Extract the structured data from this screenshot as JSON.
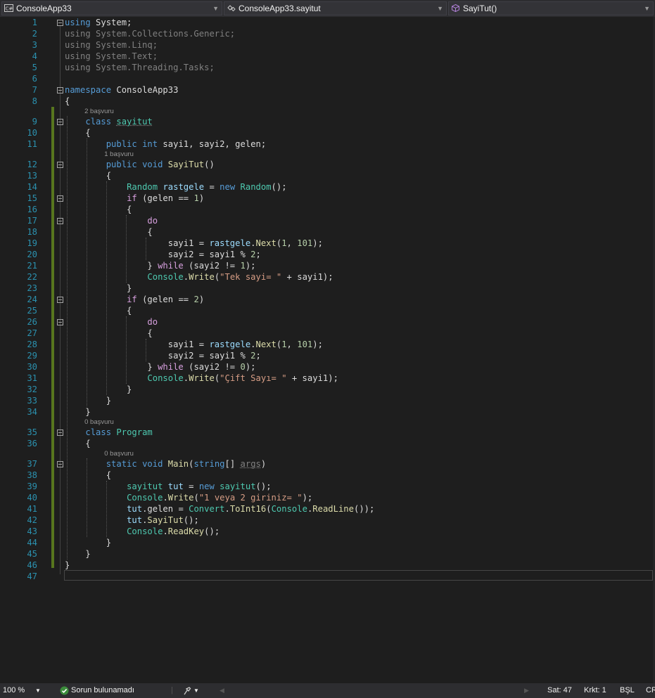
{
  "navbar": {
    "project": "ConsoleApp33",
    "type": "ConsoleApp33.sayitut",
    "member": "SayiTut()",
    "project_icon": "csharp-project-icon",
    "type_icon": "class-icon",
    "member_icon": "method-cube-icon"
  },
  "lines": [
    {
      "n": "1",
      "fold": true,
      "tokens": [
        {
          "t": "using",
          "c": "k"
        },
        {
          "t": " System;"
        }
      ]
    },
    {
      "n": "2",
      "tokens": [
        {
          "t": "using System.Collections.Generic;",
          "c": "g"
        }
      ]
    },
    {
      "n": "3",
      "tokens": [
        {
          "t": "using System.Linq;",
          "c": "g"
        }
      ]
    },
    {
      "n": "4",
      "tokens": [
        {
          "t": "using System.Text;",
          "c": "g"
        }
      ]
    },
    {
      "n": "5",
      "tokens": [
        {
          "t": "using System.Threading.Tasks;",
          "c": "g"
        }
      ]
    },
    {
      "n": "6",
      "tokens": []
    },
    {
      "n": "7",
      "fold": true,
      "tokens": [
        {
          "t": "namespace",
          "c": "k"
        },
        {
          "t": " ConsoleApp33"
        }
      ]
    },
    {
      "n": "8",
      "tokens": [
        {
          "t": "{"
        }
      ]
    },
    {
      "n": "9",
      "fold": true,
      "ref": "2 başvuru",
      "tokens": [
        {
          "t": "    "
        },
        {
          "t": "class",
          "c": "k"
        },
        {
          "t": " "
        },
        {
          "t": "sayitut",
          "c": "t",
          "u": true
        }
      ]
    },
    {
      "n": "10",
      "tokens": [
        {
          "t": "    {"
        }
      ]
    },
    {
      "n": "11",
      "tokens": [
        {
          "t": "        "
        },
        {
          "t": "public",
          "c": "k"
        },
        {
          "t": " "
        },
        {
          "t": "int",
          "c": "k"
        },
        {
          "t": " sayi1, sayi2, gelen;"
        }
      ]
    },
    {
      "n": "12",
      "fold": true,
      "ref": "1 başvuru",
      "tokens": [
        {
          "t": "        "
        },
        {
          "t": "public",
          "c": "k"
        },
        {
          "t": " "
        },
        {
          "t": "void",
          "c": "k"
        },
        {
          "t": " "
        },
        {
          "t": "SayiTut",
          "c": "m"
        },
        {
          "t": "()"
        }
      ]
    },
    {
      "n": "13",
      "tokens": [
        {
          "t": "        {"
        }
      ]
    },
    {
      "n": "14",
      "tokens": [
        {
          "t": "            "
        },
        {
          "t": "Random",
          "c": "t"
        },
        {
          "t": " "
        },
        {
          "t": "rastgele",
          "c": "v"
        },
        {
          "t": " = "
        },
        {
          "t": "new",
          "c": "k"
        },
        {
          "t": " "
        },
        {
          "t": "Random",
          "c": "t"
        },
        {
          "t": "();"
        }
      ]
    },
    {
      "n": "15",
      "fold": true,
      "tokens": [
        {
          "t": "            "
        },
        {
          "t": "if",
          "c": "c"
        },
        {
          "t": " (gelen == "
        },
        {
          "t": "1",
          "c": "n"
        },
        {
          "t": ")"
        }
      ]
    },
    {
      "n": "16",
      "tokens": [
        {
          "t": "            {"
        }
      ]
    },
    {
      "n": "17",
      "fold": true,
      "tokens": [
        {
          "t": "                "
        },
        {
          "t": "do",
          "c": "c"
        }
      ]
    },
    {
      "n": "18",
      "tokens": [
        {
          "t": "                {"
        }
      ]
    },
    {
      "n": "19",
      "tokens": [
        {
          "t": "                    sayi1 = "
        },
        {
          "t": "rastgele",
          "c": "v"
        },
        {
          "t": "."
        },
        {
          "t": "Next",
          "c": "m"
        },
        {
          "t": "("
        },
        {
          "t": "1",
          "c": "n"
        },
        {
          "t": ", "
        },
        {
          "t": "101",
          "c": "n"
        },
        {
          "t": ");"
        }
      ]
    },
    {
      "n": "20",
      "tokens": [
        {
          "t": "                    sayi2 = sayi1 % "
        },
        {
          "t": "2",
          "c": "n"
        },
        {
          "t": ";"
        }
      ]
    },
    {
      "n": "21",
      "tokens": [
        {
          "t": "                } "
        },
        {
          "t": "while",
          "c": "c"
        },
        {
          "t": " (sayi2 != "
        },
        {
          "t": "1",
          "c": "n"
        },
        {
          "t": ");"
        }
      ]
    },
    {
      "n": "22",
      "tokens": [
        {
          "t": "                "
        },
        {
          "t": "Console",
          "c": "t"
        },
        {
          "t": "."
        },
        {
          "t": "Write",
          "c": "m"
        },
        {
          "t": "("
        },
        {
          "t": "\"Tek sayi= \"",
          "c": "s"
        },
        {
          "t": " + sayi1);"
        }
      ]
    },
    {
      "n": "23",
      "tokens": [
        {
          "t": "            }"
        }
      ]
    },
    {
      "n": "24",
      "fold": true,
      "tokens": [
        {
          "t": "            "
        },
        {
          "t": "if",
          "c": "c"
        },
        {
          "t": " (gelen == "
        },
        {
          "t": "2",
          "c": "n"
        },
        {
          "t": ")"
        }
      ]
    },
    {
      "n": "25",
      "tokens": [
        {
          "t": "            {"
        }
      ]
    },
    {
      "n": "26",
      "fold": true,
      "tokens": [
        {
          "t": "                "
        },
        {
          "t": "do",
          "c": "c"
        }
      ]
    },
    {
      "n": "27",
      "tokens": [
        {
          "t": "                {"
        }
      ]
    },
    {
      "n": "28",
      "tokens": [
        {
          "t": "                    sayi1 = "
        },
        {
          "t": "rastgele",
          "c": "v"
        },
        {
          "t": "."
        },
        {
          "t": "Next",
          "c": "m"
        },
        {
          "t": "("
        },
        {
          "t": "1",
          "c": "n"
        },
        {
          "t": ", "
        },
        {
          "t": "101",
          "c": "n"
        },
        {
          "t": ");"
        }
      ]
    },
    {
      "n": "29",
      "tokens": [
        {
          "t": "                    sayi2 = sayi1 % "
        },
        {
          "t": "2",
          "c": "n"
        },
        {
          "t": ";"
        }
      ]
    },
    {
      "n": "30",
      "tokens": [
        {
          "t": "                } "
        },
        {
          "t": "while",
          "c": "c"
        },
        {
          "t": " (sayi2 != "
        },
        {
          "t": "0",
          "c": "n"
        },
        {
          "t": ");"
        }
      ]
    },
    {
      "n": "31",
      "tokens": [
        {
          "t": "                "
        },
        {
          "t": "Console",
          "c": "t"
        },
        {
          "t": "."
        },
        {
          "t": "Write",
          "c": "m"
        },
        {
          "t": "("
        },
        {
          "t": "\"Çift Sayı= \"",
          "c": "s"
        },
        {
          "t": " + sayi1);"
        }
      ]
    },
    {
      "n": "32",
      "tokens": [
        {
          "t": "            }"
        }
      ]
    },
    {
      "n": "33",
      "tokens": [
        {
          "t": "        }"
        }
      ]
    },
    {
      "n": "34",
      "tokens": [
        {
          "t": "    }"
        }
      ]
    },
    {
      "n": "35",
      "fold": true,
      "ref": "0 başvuru",
      "tokens": [
        {
          "t": "    "
        },
        {
          "t": "class",
          "c": "k"
        },
        {
          "t": " "
        },
        {
          "t": "Program",
          "c": "t"
        }
      ]
    },
    {
      "n": "36",
      "tokens": [
        {
          "t": "    {"
        }
      ]
    },
    {
      "n": "37",
      "fold": true,
      "ref": "0 başvuru",
      "tokens": [
        {
          "t": "        "
        },
        {
          "t": "static",
          "c": "k"
        },
        {
          "t": " "
        },
        {
          "t": "void",
          "c": "k"
        },
        {
          "t": " "
        },
        {
          "t": "Main",
          "c": "m"
        },
        {
          "t": "("
        },
        {
          "t": "string",
          "c": "k"
        },
        {
          "t": "[] "
        },
        {
          "t": "args",
          "c": "g",
          "u": true
        },
        {
          "t": ")"
        }
      ]
    },
    {
      "n": "38",
      "tokens": [
        {
          "t": "        {"
        }
      ]
    },
    {
      "n": "39",
      "tokens": [
        {
          "t": "            "
        },
        {
          "t": "sayitut",
          "c": "t"
        },
        {
          "t": " "
        },
        {
          "t": "tut",
          "c": "v"
        },
        {
          "t": " = "
        },
        {
          "t": "new",
          "c": "k"
        },
        {
          "t": " "
        },
        {
          "t": "sayitut",
          "c": "t"
        },
        {
          "t": "();"
        }
      ]
    },
    {
      "n": "40",
      "tokens": [
        {
          "t": "            "
        },
        {
          "t": "Console",
          "c": "t"
        },
        {
          "t": "."
        },
        {
          "t": "Write",
          "c": "m"
        },
        {
          "t": "("
        },
        {
          "t": "\"1 veya 2 giriniz= \"",
          "c": "s"
        },
        {
          "t": ");"
        }
      ]
    },
    {
      "n": "41",
      "tokens": [
        {
          "t": "            "
        },
        {
          "t": "tut",
          "c": "v"
        },
        {
          "t": ".gelen = "
        },
        {
          "t": "Convert",
          "c": "t"
        },
        {
          "t": "."
        },
        {
          "t": "ToInt16",
          "c": "m"
        },
        {
          "t": "("
        },
        {
          "t": "Console",
          "c": "t"
        },
        {
          "t": "."
        },
        {
          "t": "ReadLine",
          "c": "m"
        },
        {
          "t": "());"
        }
      ]
    },
    {
      "n": "42",
      "tokens": [
        {
          "t": "            "
        },
        {
          "t": "tut",
          "c": "v"
        },
        {
          "t": "."
        },
        {
          "t": "SayiTut",
          "c": "m"
        },
        {
          "t": "();"
        }
      ]
    },
    {
      "n": "43",
      "tokens": [
        {
          "t": "            "
        },
        {
          "t": "Console",
          "c": "t"
        },
        {
          "t": "."
        },
        {
          "t": "ReadKey",
          "c": "m"
        },
        {
          "t": "();"
        }
      ]
    },
    {
      "n": "44",
      "tokens": [
        {
          "t": "        }"
        }
      ]
    },
    {
      "n": "45",
      "tokens": [
        {
          "t": "    }"
        }
      ]
    },
    {
      "n": "46",
      "tokens": [
        {
          "t": "}"
        }
      ]
    },
    {
      "n": "47",
      "tokens": []
    }
  ],
  "status": {
    "zoom": "100 %",
    "issues_icon": "check-circle-icon",
    "issues": "Sorun bulunamadı",
    "line": "Sat: 47",
    "col": "Krkt: 1",
    "ins": "BŞL",
    "eol": "CR"
  }
}
